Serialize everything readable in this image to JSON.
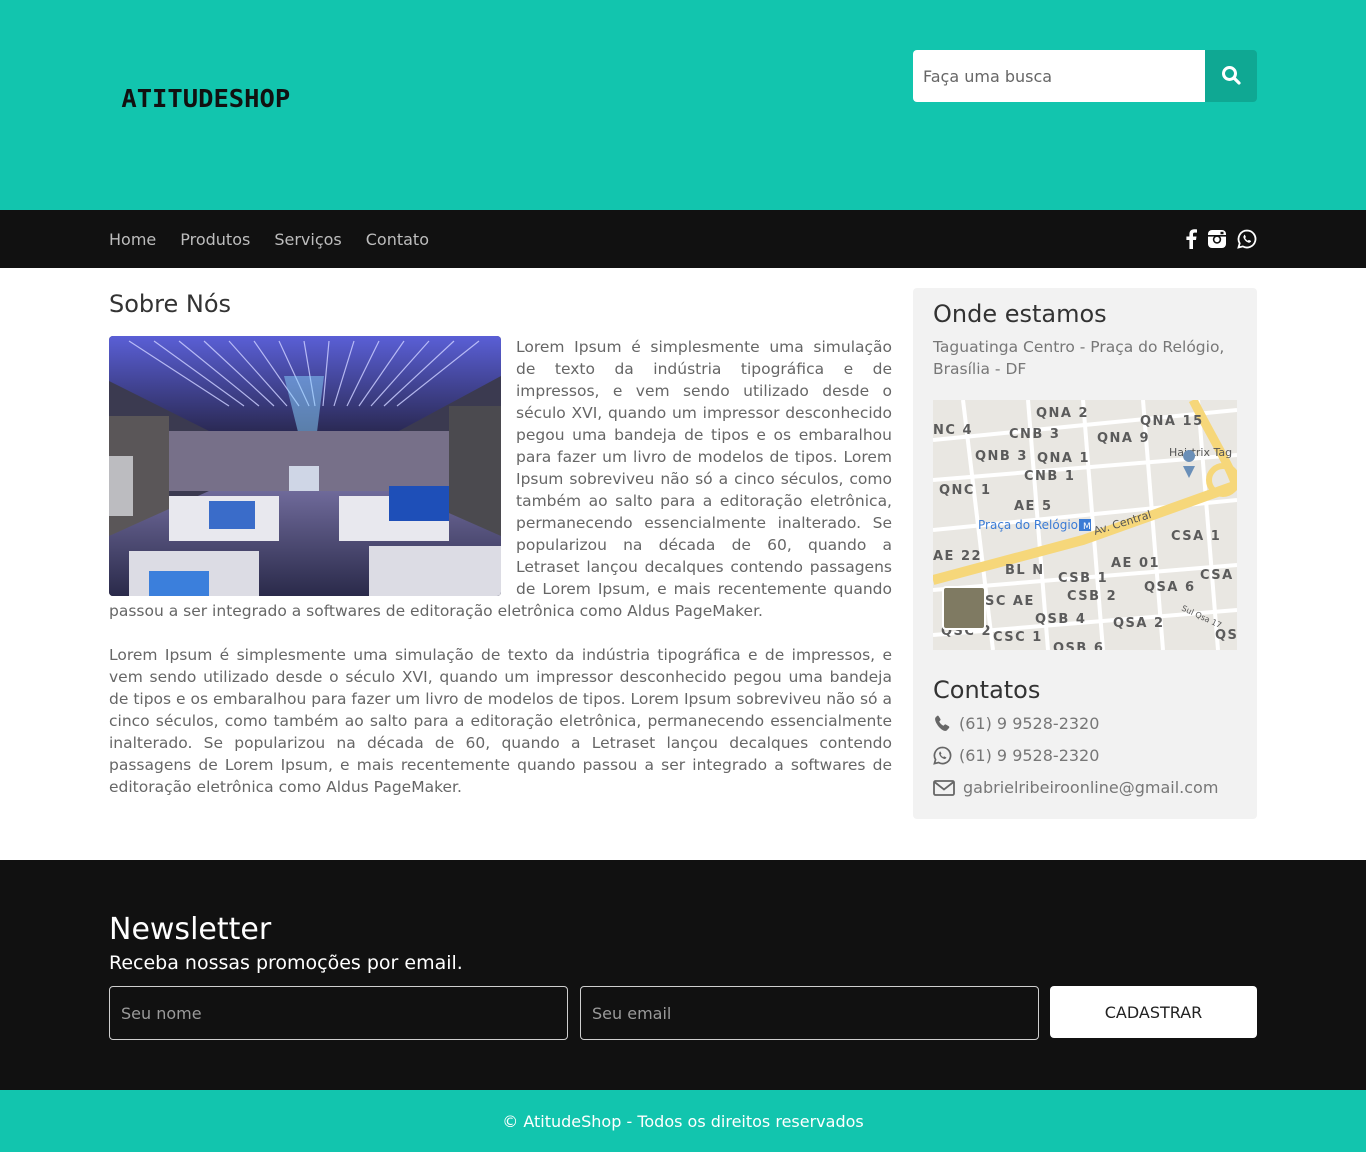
{
  "header": {
    "logo": "ATITUDESHOP",
    "search_placeholder": "Faça uma busca"
  },
  "nav": {
    "items": [
      "Home",
      "Produtos",
      "Serviços",
      "Contato"
    ],
    "social": [
      "facebook-icon",
      "instagram-icon",
      "whatsapp-icon"
    ]
  },
  "about": {
    "title": "Sobre Nós",
    "paragraph1": "Lorem Ipsum é simplesmente uma simulação de texto da indústria tipográfica e de impressos, e vem sendo utilizado desde o século XVI, quando um impressor desconhecido pegou uma bandeja de tipos e os embaralhou para fazer um livro de modelos de tipos. Lorem Ipsum sobreviveu não só a cinco séculos, como também ao salto para a editoração eletrônica, permanecendo essencialmente inalterado. Se popularizou na década de 60, quando a Letraset lançou decalques contendo passagens de Lorem Ipsum, e mais recentemente quando passou a ser integrado a softwares de editoração eletrônica como Aldus PageMaker.",
    "paragraph2": "Lorem Ipsum é simplesmente uma simulação de texto da indústria tipográfica e de impressos, e vem sendo utilizado desde o século XVI, quando um impressor desconhecido pegou uma bandeja de tipos e os embaralhou para fazer um livro de modelos de tipos. Lorem Ipsum sobreviveu não só a cinco séculos, como também ao salto para a editoração eletrônica, permanecendo essencialmente inalterado. Se popularizou na década de 60, quando a Letraset lançou decalques contendo passagens de Lorem Ipsum, e mais recentemente quando passou a ser integrado a softwares de editoração eletrônica como Aldus PageMaker."
  },
  "sidebar": {
    "location_title": "Onde estamos",
    "address": "Taguatinga Centro - Praça do Relógio, Brasília - DF",
    "map": {
      "labels": [
        "QNA 2",
        "QNA 15",
        "NC 4",
        "CNB 3",
        "QNA 9",
        "QNB 3",
        "QNA 1",
        "Hairtrix Tag",
        "CNB 1",
        "QNC 1",
        "AE 5",
        "Praça do Relógio",
        "Av. Central",
        "CSA 1",
        "AE 22",
        "BL N",
        "AE 01",
        "CSB 1",
        "QSA 6",
        "CSA",
        "SC AE",
        "CSB 2",
        "QSB 4",
        "QSA 2",
        "QSC 2",
        "CSC 1",
        "QSB 6",
        "Sul Qsa 17",
        "QS"
      ]
    },
    "contacts_title": "Contatos",
    "phone": "(61) 9 9528-2320",
    "whatsapp": "(61) 9 9528-2320",
    "email": "gabrielribeiroonline@gmail.com"
  },
  "newsletter": {
    "title": "Newsletter",
    "subtitle": "Receba nossas promoções por email.",
    "name_placeholder": "Seu nome",
    "email_placeholder": "Seu email",
    "button_label": "CADASTRAR"
  },
  "footer": {
    "text": "© AtitudeShop - Todos os direitos reservados"
  },
  "colors": {
    "brand": "#12c5ae",
    "brand_dark": "#0fa893",
    "dark": "#111111"
  }
}
